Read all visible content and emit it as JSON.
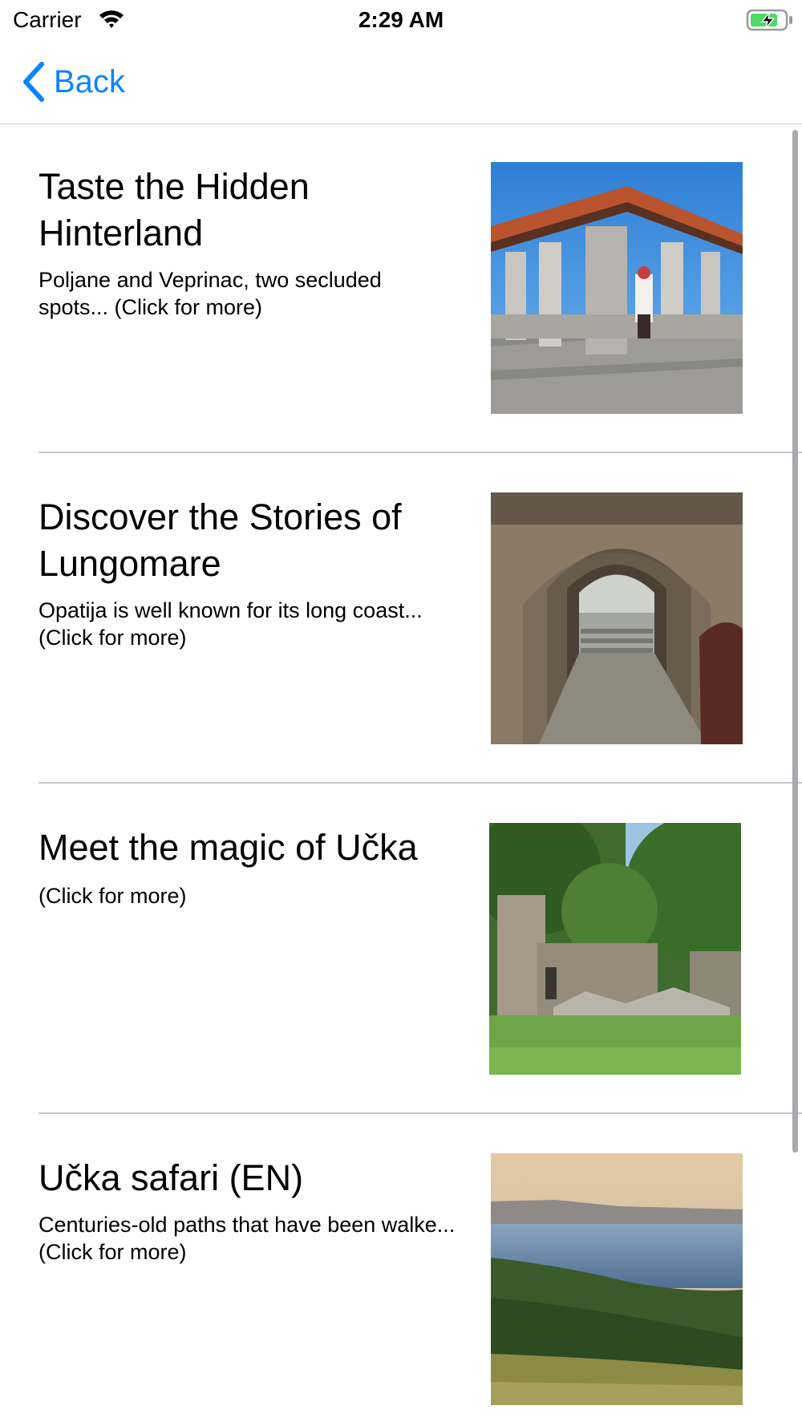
{
  "status_bar": {
    "carrier": "Carrier",
    "time": "2:29 AM",
    "wifi_icon": "wifi-icon",
    "battery_icon": "battery-charging-icon",
    "battery_color": "#4cd964"
  },
  "nav": {
    "back_label": "Back",
    "back_icon": "chevron-left-icon",
    "tint_color": "#0a84ff"
  },
  "items": [
    {
      "title": "Taste the Hidden Hinterland",
      "description": "Poljane and Veprinac, two secluded spots... (Click for more)",
      "image": "hinterland-photo"
    },
    {
      "title": "Discover the Stories of Lungomare",
      "description": "Opatija is well known for its long coast... (Click for more)",
      "image": "lungomare-photo"
    },
    {
      "title": "Meet the magic of Učka",
      "description": " (Click for more)",
      "image": "ucka-photo"
    },
    {
      "title": "Učka safari (EN)",
      "description": "Centuries-old paths that have been walke... (Click for more)",
      "image": "ucka-safari-photo"
    }
  ]
}
